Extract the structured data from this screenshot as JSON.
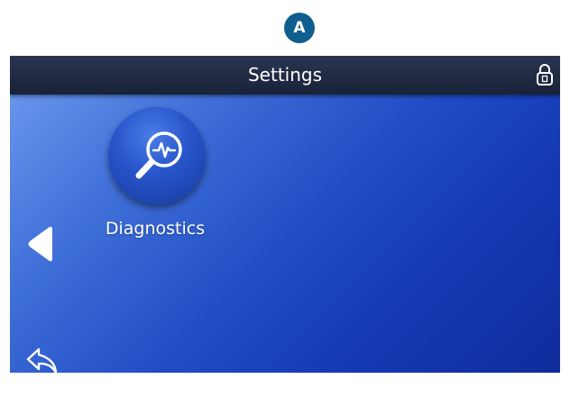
{
  "callout": {
    "label": "A",
    "color": "#0f5f8e"
  },
  "header": {
    "title": "Settings",
    "lock_icon": "lock-icon"
  },
  "menu": {
    "items": [
      {
        "label": "Diagnostics",
        "icon": "diagnostics-magnifier-icon"
      }
    ]
  },
  "navigation": {
    "prev_icon": "left-triangle-icon",
    "back_icon": "return-arrow-icon"
  },
  "colors": {
    "header_bg": "#1f2a42",
    "screen_bg_light": "#6f9cf0",
    "screen_bg_dark": "#0f2c9c",
    "text": "#ffffff"
  }
}
